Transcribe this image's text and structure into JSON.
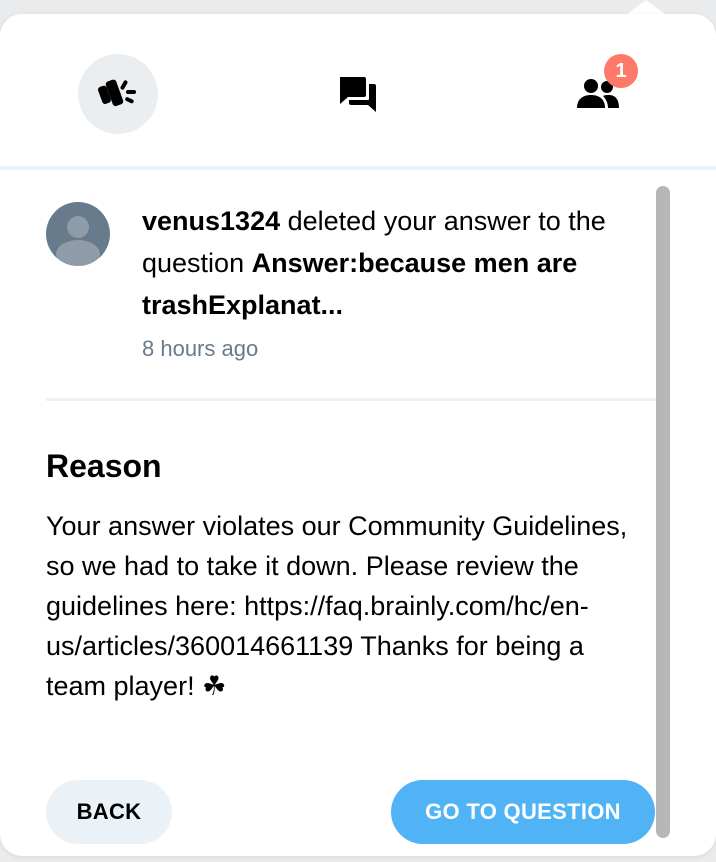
{
  "tabs": [
    {
      "icon": "megaphone-icon",
      "active": true
    },
    {
      "icon": "chat-bubbles-icon",
      "active": false
    },
    {
      "icon": "users-icon",
      "active": false,
      "badge": "1"
    }
  ],
  "notification": {
    "username": "venus1324",
    "action_text": " deleted your answer to the question ",
    "question_title": "Answer:because men are trashExplanat...",
    "time": "8 hours ago"
  },
  "reason": {
    "title": "Reason",
    "body": "Your answer violates our Community Guidelines, so we had to take it down. Please review the guidelines here: https://faq.brainly.com/hc/en-us/articles/360014661139 Thanks for being a team player! ☘"
  },
  "buttons": {
    "back": "BACK",
    "go_to_question": "GO TO QUESTION"
  },
  "colors": {
    "accent_blue": "#4fb3f6",
    "badge_red": "#ff7968",
    "muted_gray": "#687b8c",
    "divider": "#ebf2f7"
  }
}
